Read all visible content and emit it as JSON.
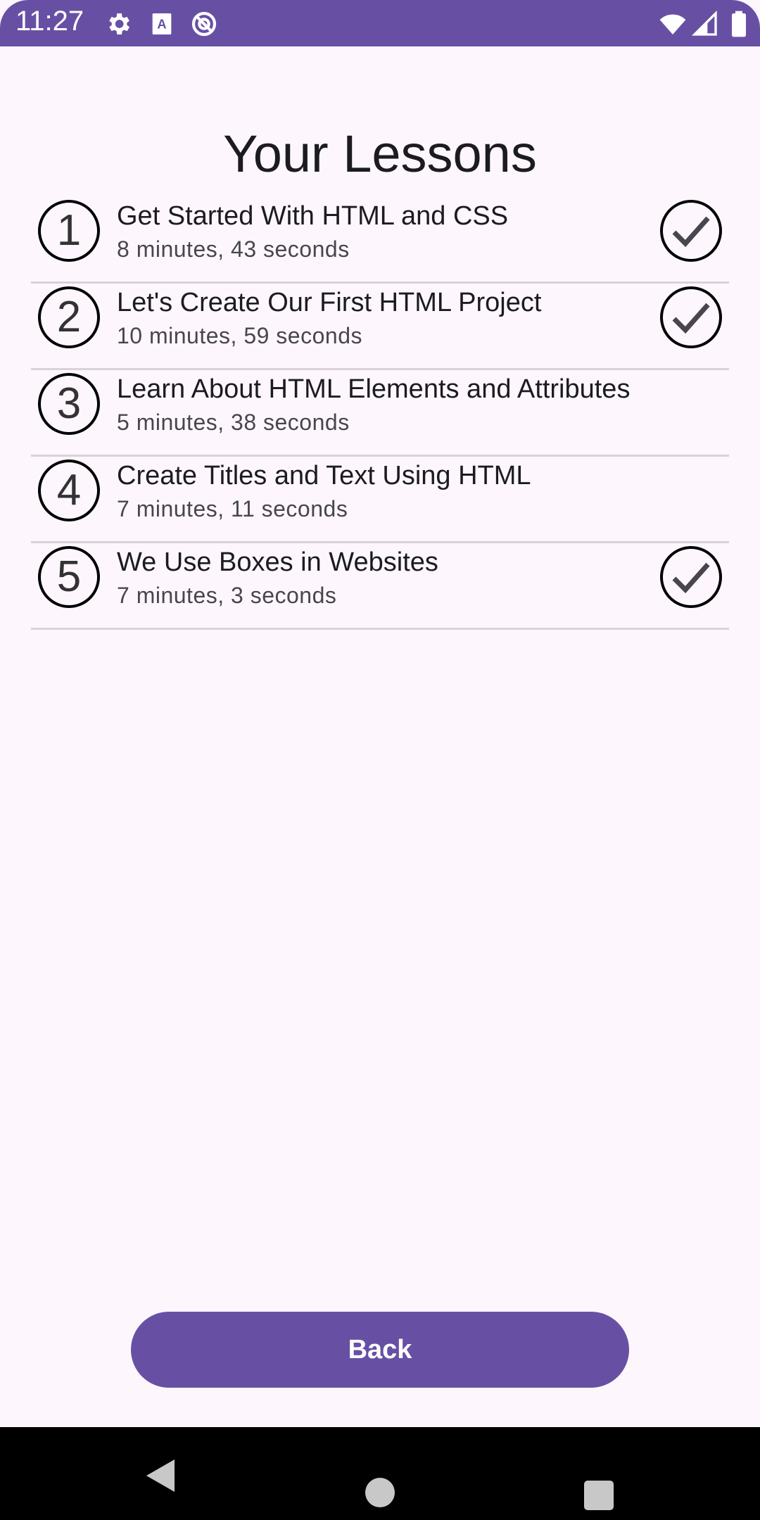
{
  "status_bar": {
    "time": "11:27",
    "left_icons": [
      "gear-icon",
      "keyboard-a-icon",
      "no-data-icon"
    ],
    "right_icons": [
      "wifi-icon",
      "signal-icon",
      "battery-icon"
    ]
  },
  "page_title": "Your Lessons",
  "lessons": [
    {
      "number": "1",
      "title": "Get Started With HTML and CSS",
      "duration": "8 minutes, 43 seconds",
      "completed": true
    },
    {
      "number": "2",
      "title": "Let's Create Our First HTML Project",
      "duration": "10 minutes, 59 seconds",
      "completed": true
    },
    {
      "number": "3",
      "title": "Learn About HTML Elements and Attributes",
      "duration": "5 minutes, 38 seconds",
      "completed": false
    },
    {
      "number": "4",
      "title": "Create Titles and Text Using HTML",
      "duration": "7 minutes, 11 seconds",
      "completed": false
    },
    {
      "number": "5",
      "title": "We Use Boxes in Websites",
      "duration": "7 minutes, 3 seconds",
      "completed": true
    }
  ],
  "back_button": "Back",
  "nav_bar": {
    "icons": [
      "back-triangle-icon",
      "home-circle-icon",
      "recents-square-icon"
    ]
  },
  "colors": {
    "accent": "#6750A4",
    "background": "#FDF7FD",
    "divider": "#D9D3D9"
  }
}
